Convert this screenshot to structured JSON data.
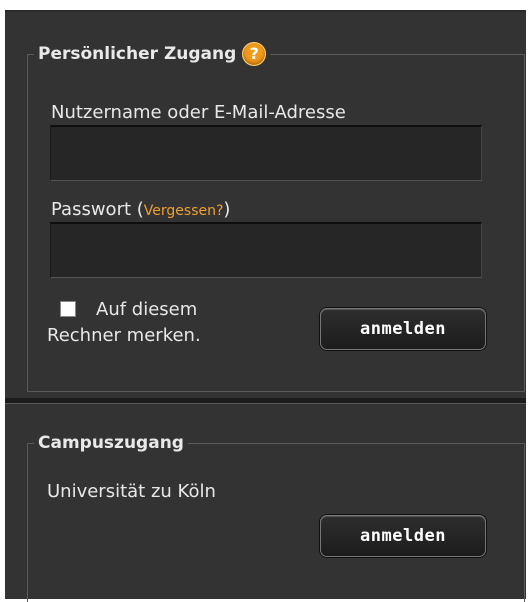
{
  "personal": {
    "title": "Persönlicher Zugang",
    "help_icon": "?",
    "username_label": "Nutzername oder E-Mail-Adresse",
    "username_value": "",
    "password_label": "Passwort",
    "forgot_open": "(",
    "forgot_link": "Vergessen?",
    "forgot_close": ")",
    "password_value": "",
    "remember_line1": "Auf diesem",
    "remember_line2": "Rechner merken.",
    "login_button": "anmelden"
  },
  "campus": {
    "title": "Campuszugang",
    "institution": "Universität zu Köln",
    "login_button": "anmelden"
  },
  "colors": {
    "panel_bg": "#333333",
    "link": "#f0a030",
    "help_icon": "#f09a1c"
  }
}
